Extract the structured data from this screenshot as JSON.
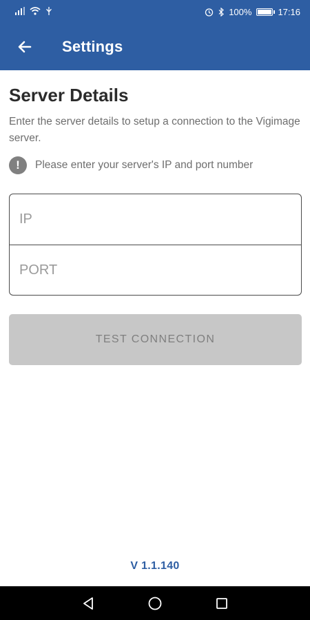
{
  "status_bar": {
    "battery_percent": "100%",
    "time": "17:16"
  },
  "app_bar": {
    "title": "Settings"
  },
  "section": {
    "title": "Server Details",
    "description": "Enter the server details to setup a connection to the Vigimage server.",
    "hint": "Please enter your server's IP and port number",
    "hint_icon_glyph": "!"
  },
  "form": {
    "ip": {
      "value": "",
      "placeholder": "IP"
    },
    "port": {
      "value": "",
      "placeholder": "PORT"
    },
    "test_button_label": "TEST CONNECTION"
  },
  "footer": {
    "version": "V 1.1.140"
  },
  "icons": {
    "back": "arrow-left-icon",
    "hint": "exclamation-circle-icon",
    "nav_back": "triangle-back-icon",
    "nav_home": "circle-home-icon",
    "nav_recents": "square-recents-icon"
  },
  "colors": {
    "primary": "#2e5ea3",
    "button_disabled": "#c7c7c7",
    "button_text_disabled": "#7f7f7f"
  }
}
